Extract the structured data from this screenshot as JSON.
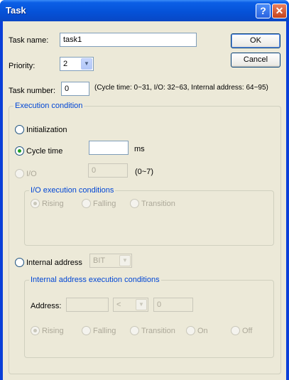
{
  "window": {
    "title": "Task",
    "help_label": "?",
    "close_label": "✕"
  },
  "task_name": {
    "label": "Task name:",
    "value": "task1"
  },
  "priority": {
    "label": "Priority:",
    "value": "2"
  },
  "task_number": {
    "label": "Task number:",
    "value": "0",
    "hint": "(Cycle time: 0~31, I/O: 32~63, Internal address: 64~95)"
  },
  "buttons": {
    "ok": "OK",
    "cancel": "Cancel"
  },
  "execution_condition": {
    "legend": "Execution condition",
    "initialization": "Initialization",
    "cycle_time": {
      "label": "Cycle time",
      "value": "",
      "unit": "ms"
    },
    "io": {
      "label": "I/O",
      "value": "0",
      "range": "(0~7)"
    },
    "io_conditions": {
      "legend": "I/O execution conditions",
      "rising": "Rising",
      "falling": "Falling",
      "transition": "Transition"
    },
    "internal_address": {
      "label": "Internal address",
      "type_value": "BIT"
    },
    "internal_conditions": {
      "legend": "Internal address execution conditions",
      "address_label": "Address:",
      "address_value": "",
      "operator_value": "<",
      "compare_value": "0",
      "rising": "Rising",
      "falling": "Falling",
      "transition": "Transition",
      "on": "On",
      "off": "Off"
    }
  }
}
